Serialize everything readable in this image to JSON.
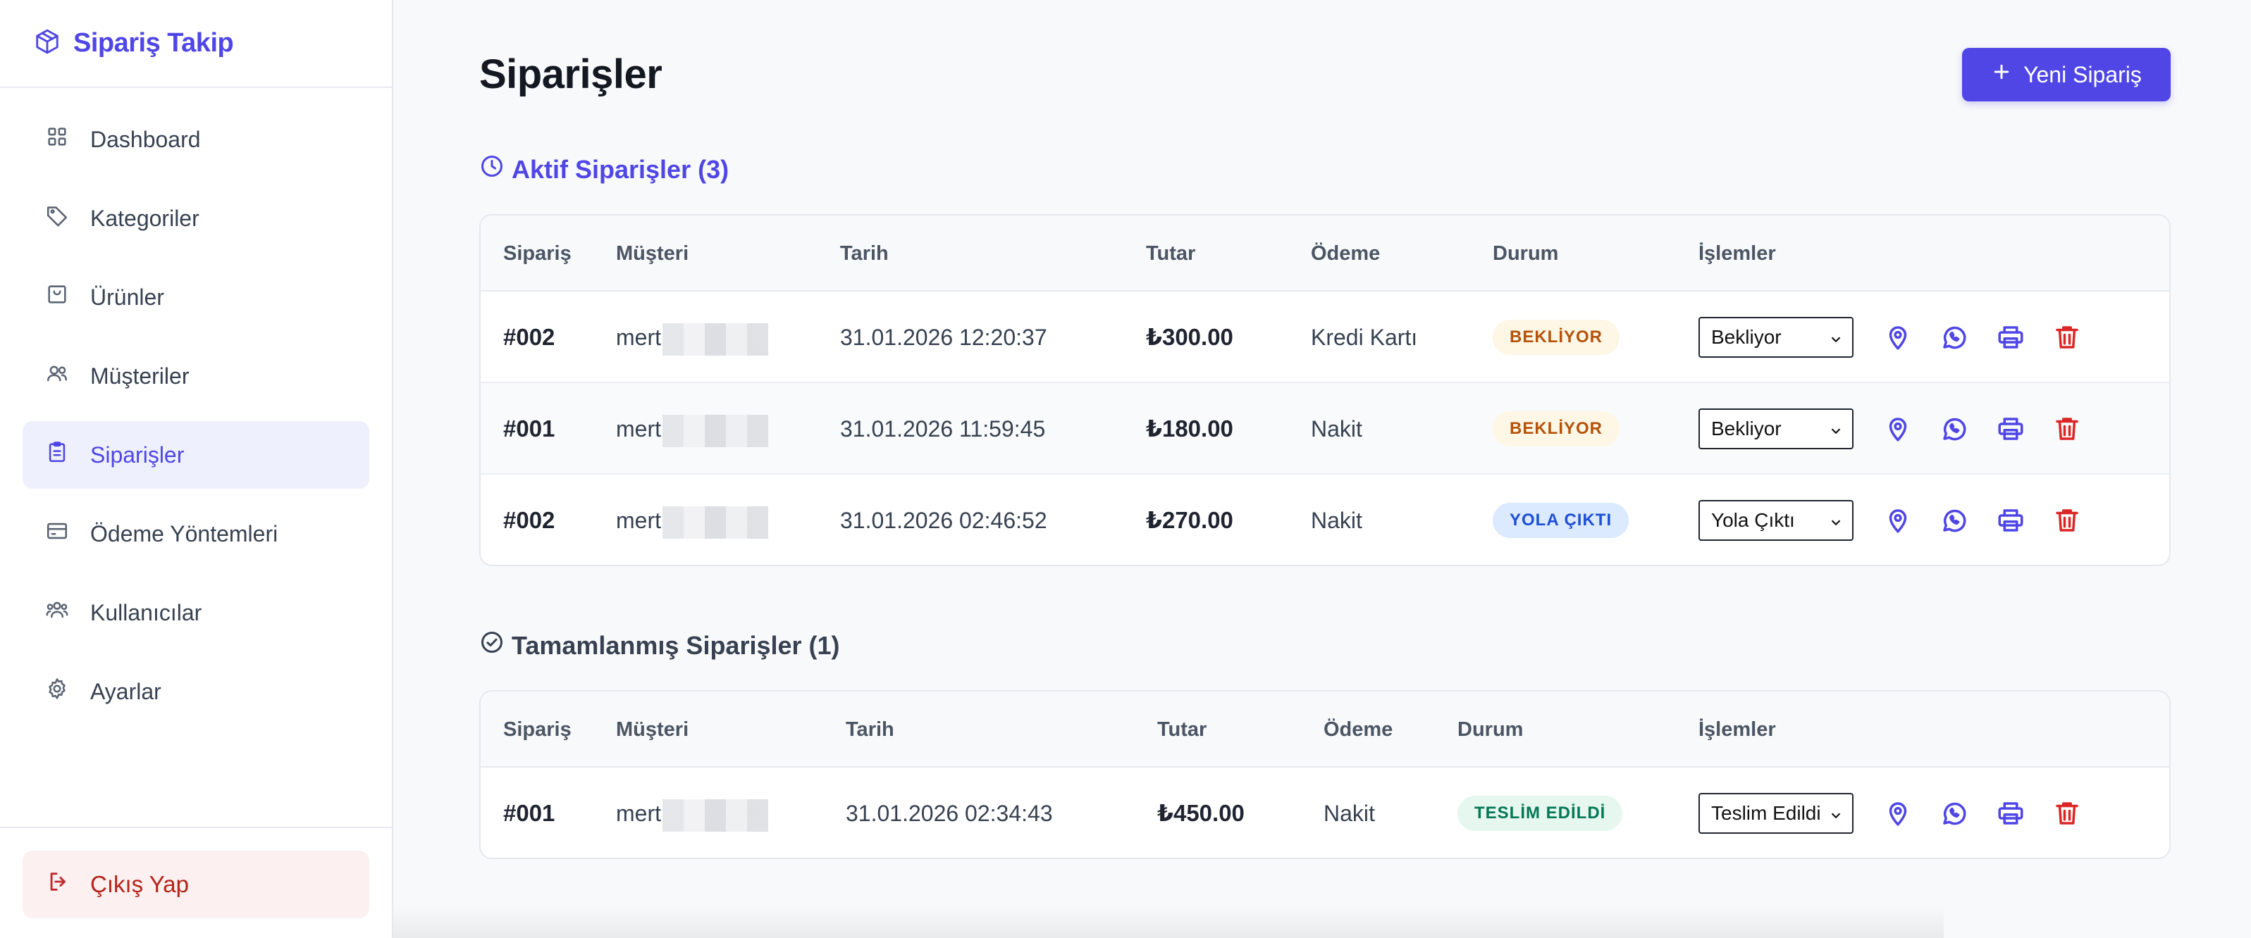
{
  "brand": {
    "title": "Sipariş Takip"
  },
  "sidebar": {
    "items": [
      {
        "label": "Dashboard",
        "icon": "grid-icon"
      },
      {
        "label": "Kategoriler",
        "icon": "tag-icon"
      },
      {
        "label": "Ürünler",
        "icon": "box-icon"
      },
      {
        "label": "Müşteriler",
        "icon": "users-icon"
      },
      {
        "label": "Siparişler",
        "icon": "clipboard-icon",
        "active": true
      },
      {
        "label": "Ödeme Yöntemleri",
        "icon": "credit-card-icon"
      },
      {
        "label": "Kullanıcılar",
        "icon": "group-icon"
      },
      {
        "label": "Ayarlar",
        "icon": "gear-icon"
      }
    ],
    "logout_label": "Çıkış Yap"
  },
  "header": {
    "title": "Siparişler",
    "new_order_label": "Yeni Sipariş"
  },
  "active_orders": {
    "title": "Aktif Siparişler (3)",
    "columns": [
      "Sipariş",
      "Müşteri",
      "Tarih",
      "Tutar",
      "Ödeme",
      "Durum",
      "İşlemler"
    ],
    "rows": [
      {
        "id": "#002",
        "customer": "mert",
        "date": "31.01.2026 12:20:37",
        "amount": "₺300.00",
        "payment": "Kredi Kartı",
        "status": "BEKLİYOR",
        "select": "Bekliyor"
      },
      {
        "id": "#001",
        "customer": "mert",
        "date": "31.01.2026 11:59:45",
        "amount": "₺180.00",
        "payment": "Nakit",
        "status": "BEKLİYOR",
        "select": "Bekliyor"
      },
      {
        "id": "#002",
        "customer": "mert",
        "date": "31.01.2026 02:46:52",
        "amount": "₺270.00",
        "payment": "Nakit",
        "status": "YOLA ÇIKTI",
        "select": "Yola Çıktı"
      }
    ]
  },
  "completed_orders": {
    "title": "Tamamlanmış Siparişler (1)",
    "columns": [
      "Sipariş",
      "Müşteri",
      "Tarih",
      "Tutar",
      "Ödeme",
      "Durum",
      "İşlemler"
    ],
    "rows": [
      {
        "id": "#001",
        "customer": "mert",
        "date": "31.01.2026 02:34:43",
        "amount": "₺450.00",
        "payment": "Nakit",
        "status": "TESLİM EDİLDİ",
        "select": "Teslim Edildi"
      }
    ]
  },
  "colors": {
    "accent": "#4f46e5",
    "danger": "#dc2626",
    "pending": "#b45309",
    "shipped": "#1d4ed8",
    "delivered": "#047857"
  }
}
